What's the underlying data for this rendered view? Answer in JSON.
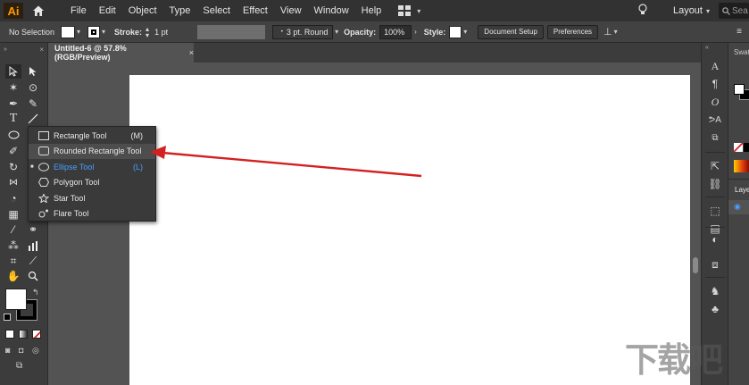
{
  "app": {
    "logo": "Ai",
    "accent": "#ff9a00"
  },
  "menu": [
    "File",
    "Edit",
    "Object",
    "Type",
    "Select",
    "Effect",
    "View",
    "Window",
    "Help"
  ],
  "menubar_right": {
    "layout_label": "Layout",
    "search_placeholder": "Sea"
  },
  "control_bar": {
    "selection_label": "No Selection",
    "stroke_label": "Stroke:",
    "stroke_value": "1 pt",
    "brush_value": "3 pt. Round",
    "opacity_label": "Opacity:",
    "opacity_value": "100%",
    "style_label": "Style:",
    "document_setup": "Document Setup",
    "preferences": "Preferences"
  },
  "document_tab": {
    "title": "Untitled-6 @ 57.8% (RGB/Preview)",
    "close": "×"
  },
  "flyout": {
    "items": [
      {
        "label": "Rectangle Tool",
        "key": "(M)",
        "icon": "rectangle-icon"
      },
      {
        "label": "Rounded Rectangle Tool",
        "key": "",
        "icon": "rounded-rectangle-icon"
      },
      {
        "label": "Ellipse Tool",
        "key": "(L)",
        "icon": "ellipse-icon"
      },
      {
        "label": "Polygon Tool",
        "key": "",
        "icon": "polygon-icon"
      },
      {
        "label": "Star Tool",
        "key": "",
        "icon": "star-icon"
      },
      {
        "label": "Flare Tool",
        "key": "",
        "icon": "flare-icon"
      }
    ],
    "active_color": "#4a9eff"
  },
  "annotation": {
    "arrow_color": "#d42020"
  },
  "right_panel": {
    "swatches_label": "Swat",
    "layers_label": "Layer"
  },
  "watermark": "下载吧"
}
